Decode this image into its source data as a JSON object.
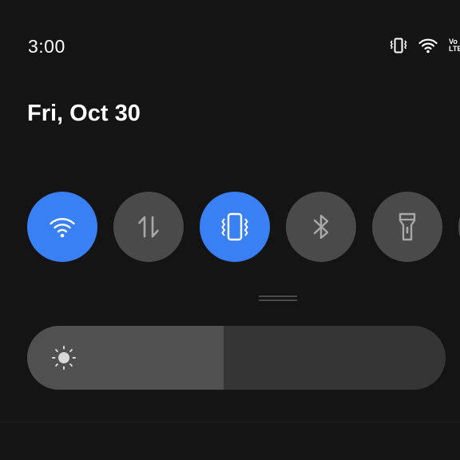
{
  "status_bar": {
    "time": "3:00",
    "icons": [
      "vibrate-icon",
      "wifi-icon",
      "volte-icon"
    ],
    "volte_label_top": "Vo",
    "volte_label_bottom": "LTE"
  },
  "header": {
    "date": "Fri, Oct 30"
  },
  "quick_settings": {
    "tiles": [
      {
        "name": "wifi",
        "icon": "wifi-icon",
        "active": true
      },
      {
        "name": "mobile-data",
        "icon": "data-arrows-icon",
        "active": false
      },
      {
        "name": "vibrate",
        "icon": "vibrate-icon",
        "active": true
      },
      {
        "name": "bluetooth",
        "icon": "bluetooth-icon",
        "active": false
      },
      {
        "name": "flashlight",
        "icon": "flashlight-icon",
        "active": false
      },
      {
        "name": "partial-tile",
        "icon": "",
        "active": false
      }
    ]
  },
  "brightness": {
    "level": 0.47,
    "icon": "sun-icon"
  },
  "colors": {
    "background": "#141414",
    "active_tile": "#3a80f5",
    "inactive_tile": "#4a4a4a",
    "slider_track": "#353535",
    "slider_fill": "#505050"
  }
}
